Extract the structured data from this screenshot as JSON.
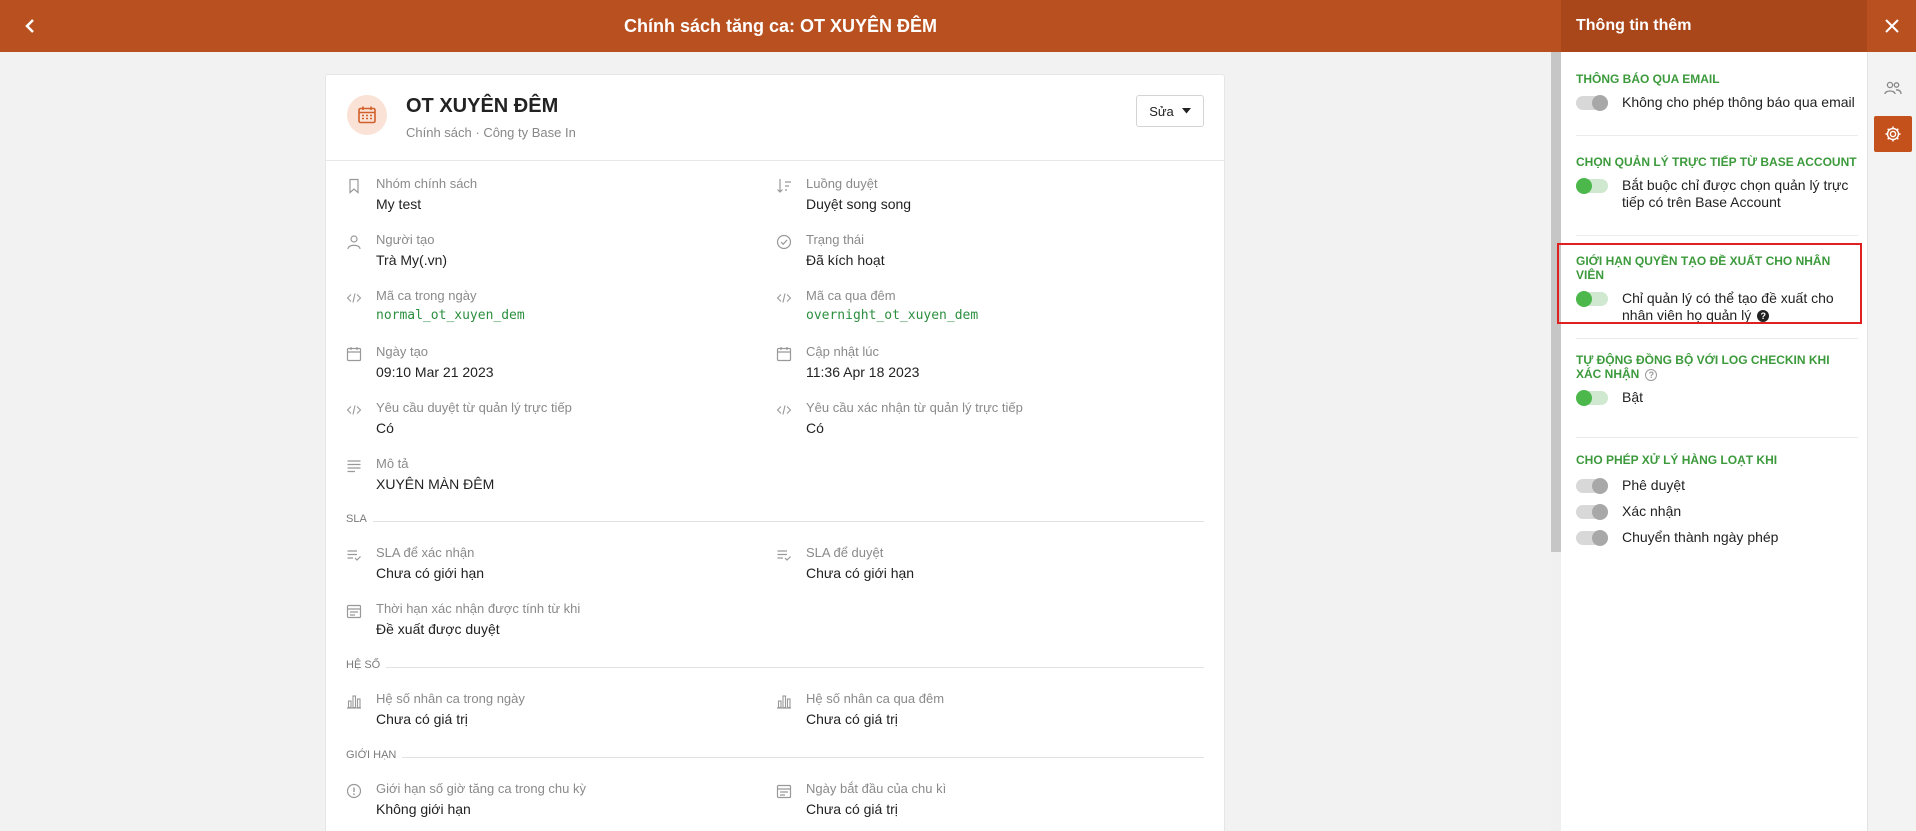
{
  "header": {
    "title": "Chính sách tăng ca: OT XUYÊN ĐÊM"
  },
  "policy": {
    "name": "OT XUYÊN ĐÊM",
    "subtitle": "Chính sách · Công ty Base In",
    "edit_label": "Sửa"
  },
  "fields": {
    "group": {
      "label": "Nhóm chính sách",
      "value": "My test"
    },
    "flow": {
      "label": "Luồng duyệt",
      "value": "Duyệt song song"
    },
    "creator": {
      "label": "Người tạo",
      "value": "Trà My(.vn)"
    },
    "status": {
      "label": "Trạng thái",
      "value": "Đã kích hoạt"
    },
    "day_code": {
      "label": "Mã ca trong ngày",
      "value": "normal_ot_xuyen_dem"
    },
    "night_code": {
      "label": "Mã ca qua đêm",
      "value": "overnight_ot_xuyen_dem"
    },
    "created": {
      "label": "Ngày tạo",
      "value": "09:10 Mar 21 2023"
    },
    "updated": {
      "label": "Cập nhật lúc",
      "value": "11:36 Apr 18 2023"
    },
    "req_approve": {
      "label": "Yêu cầu duyệt từ quản lý trực tiếp",
      "value": "Có"
    },
    "req_confirm": {
      "label": "Yêu cầu xác nhận từ quản lý trực tiếp",
      "value": "Có"
    },
    "desc": {
      "label": "Mô tả",
      "value": "XUYÊN MÀN ĐÊM"
    },
    "sla_confirm": {
      "label": "SLA để xác nhận",
      "value": "Chưa có giới hạn"
    },
    "sla_approve": {
      "label": "SLA để duyệt",
      "value": "Chưa có giới hạn"
    },
    "confirm_deadline": {
      "label": "Thời hạn xác nhận được tính từ khi",
      "value": "Đề xuất được duyệt"
    },
    "day_coef": {
      "label": "Hệ số nhân ca trong ngày",
      "value": "Chưa có giá trị"
    },
    "night_coef": {
      "label": "Hệ số nhân ca qua đêm",
      "value": "Chưa có giá trị"
    },
    "ot_limit": {
      "label": "Giới hạn số giờ tăng ca trong chu kỳ",
      "value": "Không giới hạn"
    },
    "cycle_start": {
      "label": "Ngày bắt đầu của chu kì",
      "value": "Chưa có giá trị"
    }
  },
  "sections": {
    "sla": "SLA",
    "coef": "HỆ SỐ",
    "limit": "GIỚI HẠN"
  },
  "side": {
    "title": "Thông tin thêm",
    "email": {
      "title": "THÔNG BÁO QUA EMAIL",
      "option": "Không cho phép thông báo qua email",
      "on": false
    },
    "manager": {
      "title": "CHỌN QUẢN LÝ TRỰC TIẾP TỪ BASE ACCOUNT",
      "option": "Bắt buộc chỉ được chọn quản lý trực tiếp có trên Base Account",
      "on": true
    },
    "restrict": {
      "title": "GIỚI HẠN QUYỀN TẠO ĐỀ XUẤT CHO NHÂN VIÊN",
      "option": "Chỉ quản lý có thể tạo đề xuất cho nhân viên họ quản lý",
      "on": true
    },
    "sync": {
      "title": "TỰ ĐỘNG ĐỒNG BỘ VỚI LOG CHECKIN KHI XÁC NHẬN",
      "option": "Bật",
      "on": true
    },
    "batch": {
      "title": "CHO PHÉP XỬ LÝ HÀNG LOẠT KHI",
      "options": [
        {
          "label": "Phê duyệt",
          "on": false
        },
        {
          "label": "Xác nhận",
          "on": false
        },
        {
          "label": "Chuyển thành ngày phép",
          "on": false
        }
      ]
    }
  },
  "colors": {
    "brand": "#b9501f",
    "accent_green": "#4cb84c",
    "highlight": "#e02020"
  }
}
